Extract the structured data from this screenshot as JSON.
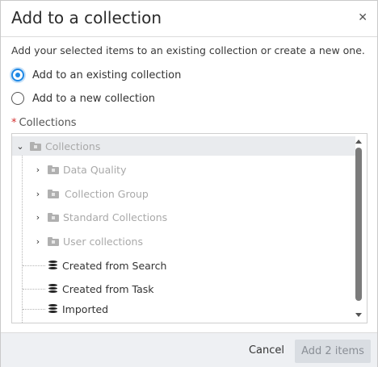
{
  "dialog": {
    "title": "Add to a collection",
    "close_icon": "close-icon",
    "description": "Add your selected items to an existing collection or create a new one."
  },
  "options": {
    "existing_label": "Add to an existing collection",
    "new_label": "Add to a new collection",
    "selected": "existing"
  },
  "collections_field": {
    "required_marker": "*",
    "label": "Collections"
  },
  "tree": {
    "root": {
      "label": "Collections",
      "expanded": true,
      "icon": "folder-lock-icon",
      "enabled": false
    },
    "folders": [
      {
        "label": "Data Quality",
        "icon": "folder-lock-icon",
        "enabled": false
      },
      {
        "label": "Collection Group",
        "icon": "folder-lock-icon",
        "enabled": false
      },
      {
        "label": "Standard Collections",
        "icon": "folder-lock-icon",
        "enabled": false
      },
      {
        "label": "User collections",
        "icon": "folder-lock-icon",
        "enabled": false
      }
    ],
    "collections": [
      {
        "label": "Created from Search",
        "icon": "database-icon",
        "enabled": true
      },
      {
        "label": "Created from Task",
        "icon": "database-icon",
        "enabled": true
      },
      {
        "label": "Imported",
        "icon": "database-icon",
        "enabled": true
      }
    ]
  },
  "footer": {
    "cancel_label": "Cancel",
    "add_label": "Add 2 items"
  },
  "colors": {
    "accent": "#1e88e5",
    "required": "#d32f2f",
    "disabled_text": "#a9a9a9",
    "footer_bg": "#eef0f3"
  }
}
